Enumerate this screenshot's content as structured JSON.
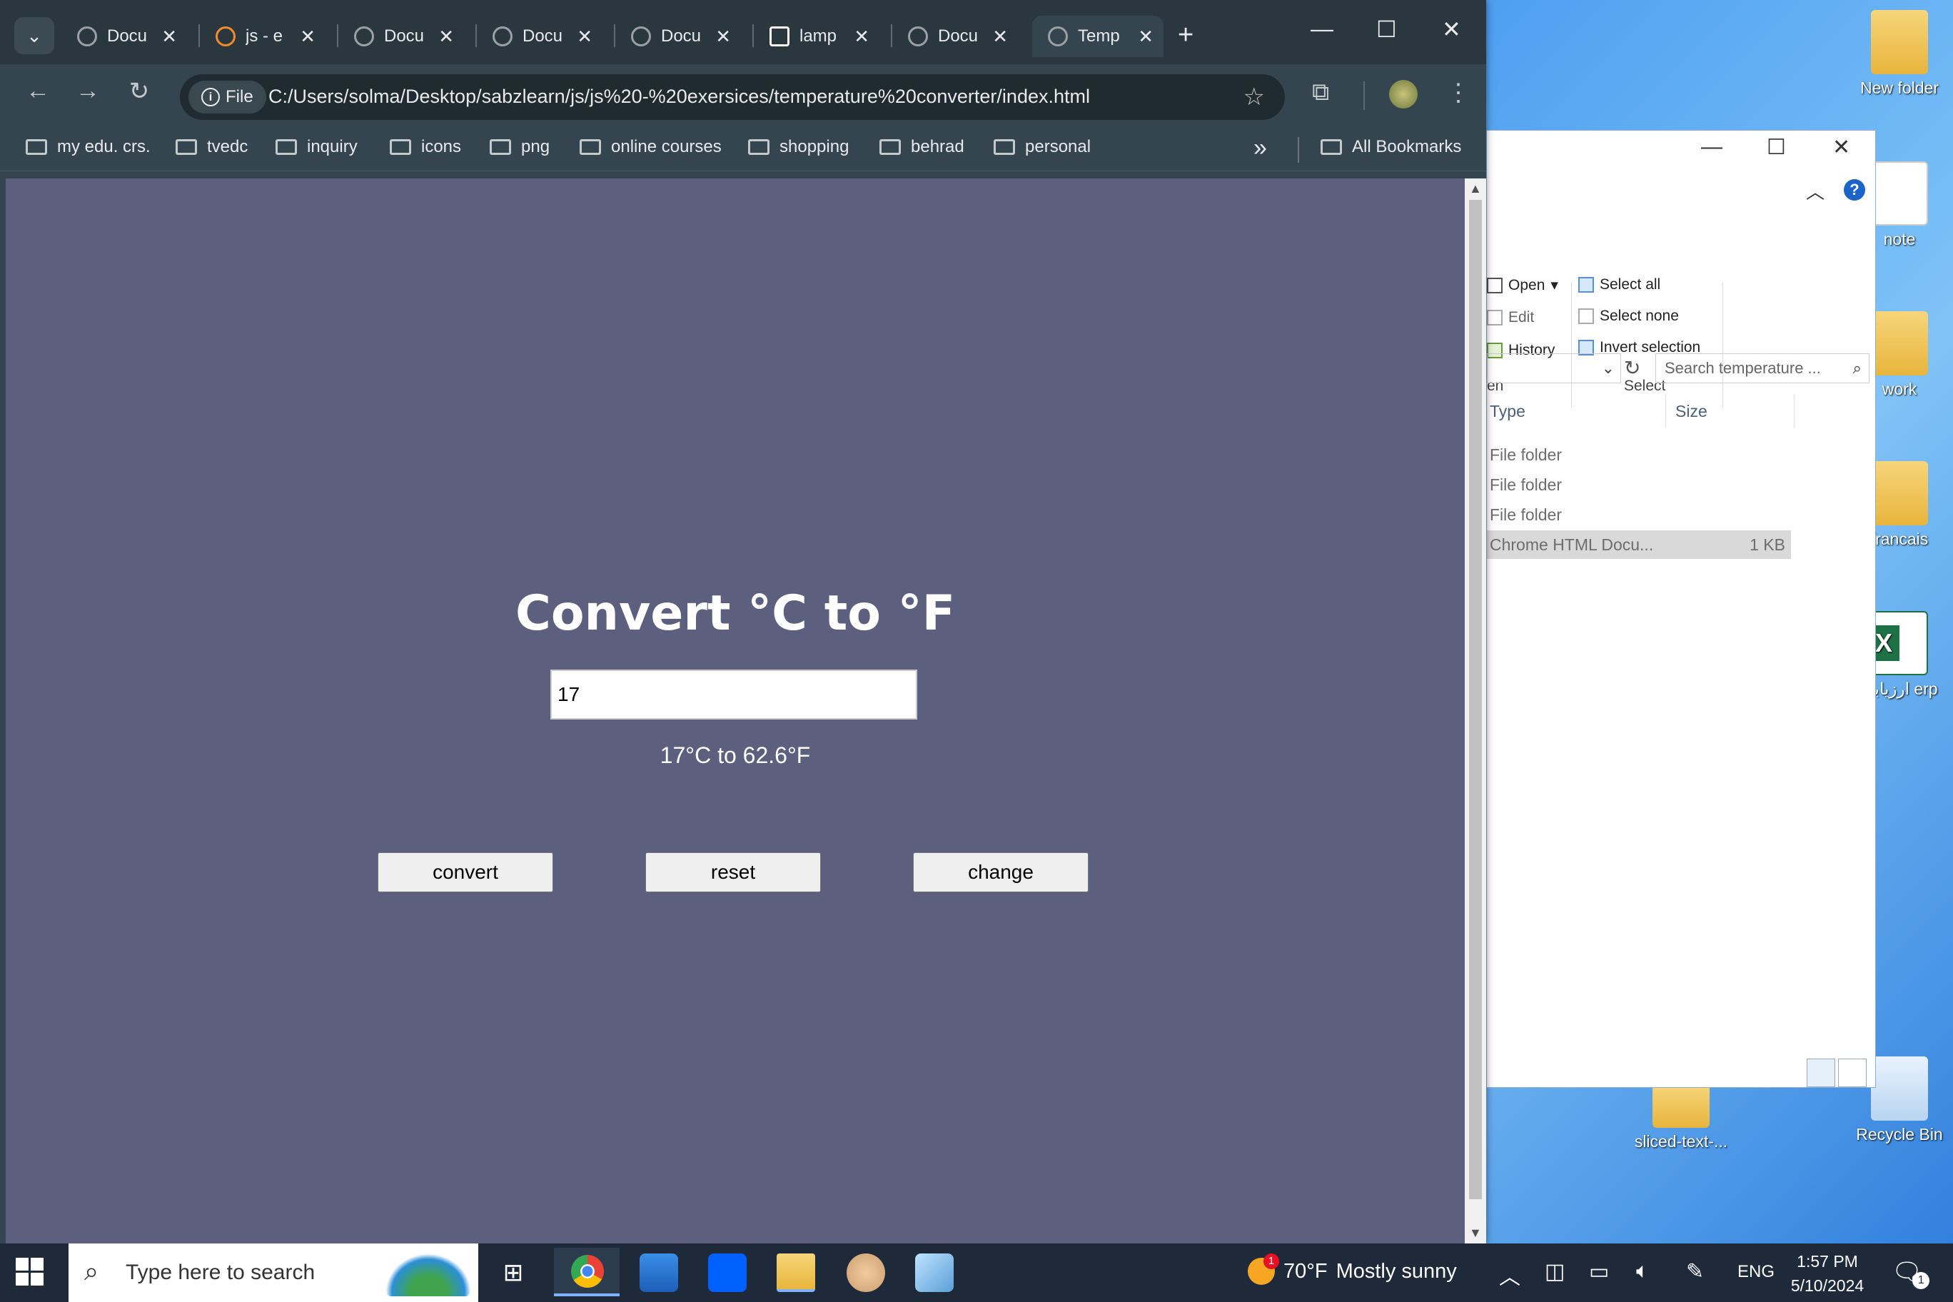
{
  "browser": {
    "tabs": [
      {
        "label": "Docu",
        "icon": "globe-icon"
      },
      {
        "label": "js - e",
        "icon": "orange-logo-icon"
      },
      {
        "label": "Docu",
        "icon": "globe-icon"
      },
      {
        "label": "Docu",
        "icon": "globe-icon"
      },
      {
        "label": "Docu",
        "icon": "globe-icon"
      },
      {
        "label": "lamp",
        "icon": "lamp-icon"
      },
      {
        "label": "Docu",
        "icon": "globe-icon"
      },
      {
        "label": "Temp",
        "icon": "globe-icon",
        "active": true
      }
    ],
    "site_chip": "File",
    "url": "C:/Users/solma/Desktop/sabzlearn/js/js%20-%20exersices/temperature%20converter/index.html",
    "bookmarks": [
      "my edu. crs.",
      "tvedc",
      "inquiry",
      "icons",
      "png",
      "online courses",
      "shopping",
      "behrad",
      "personal"
    ],
    "all_bookmarks": "All Bookmarks"
  },
  "page": {
    "title": "Convert °C to °F",
    "input_value": "17",
    "result": "17°C to 62.6°F",
    "buttons": {
      "convert": "convert",
      "reset": "reset",
      "change": "change"
    },
    "background_color": "#5d5f7e"
  },
  "explorer": {
    "ribbon": {
      "open": "Open",
      "edit": "Edit",
      "history": "History",
      "open_group": "en",
      "select_all": "Select all",
      "select_none": "Select none",
      "invert_selection": "Invert selection",
      "select_group": "Select"
    },
    "search_placeholder": "Search temperature ...",
    "columns": {
      "type": "Type",
      "size": "Size"
    },
    "rows": [
      {
        "type": "File folder",
        "size": ""
      },
      {
        "type": "File folder",
        "size": ""
      },
      {
        "type": "File folder",
        "size": ""
      },
      {
        "type": "Chrome HTML Docu...",
        "size": "1 KB"
      }
    ]
  },
  "desktop": {
    "icons": [
      "New folder",
      "note",
      "work",
      "francais",
      "ارزیابی erp",
      "sliced-text-...",
      "Recycle Bin"
    ]
  },
  "taskbar": {
    "search_placeholder": "Type here to search",
    "weather_temp": "70°F",
    "weather_desc": "Mostly sunny",
    "weather_badge": "1",
    "language": "ENG",
    "time": "1:57 PM",
    "date": "5/10/2024",
    "notification_count": "1"
  }
}
